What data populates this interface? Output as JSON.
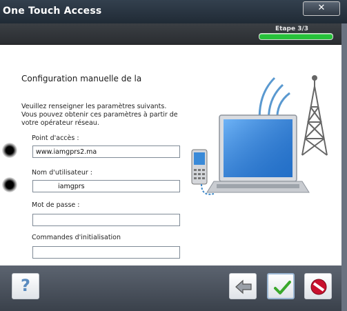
{
  "window": {
    "title": "One Touch Access",
    "close_icon": "close-icon"
  },
  "header": {
    "step_label": "Etape 3/3",
    "progress": 1.0
  },
  "main": {
    "heading": "Configuration manuelle de la",
    "instructions": "Veuillez renseigner les paramètres suivants. Vous pouvez obtenir ces paramètres à partir de votre opérateur réseau.",
    "fields": [
      {
        "label": "Point d'accès :",
        "value": "www.iamgprs2.ma"
      },
      {
        "label": "Nom d'utilisateur :",
        "value": "iamgprs"
      },
      {
        "label": "Mot de passe :",
        "value": ""
      },
      {
        "label": "Commandes d'initialisation",
        "value": ""
      }
    ]
  },
  "footer": {
    "help_label": "?",
    "icons": [
      "help-icon",
      "back-arrow-icon",
      "check-icon",
      "cancel-icon"
    ]
  },
  "colors": {
    "progress": "#27c13a",
    "check": "#3aa82b",
    "cancel": "#c8102e",
    "help": "#5a8bbf"
  }
}
